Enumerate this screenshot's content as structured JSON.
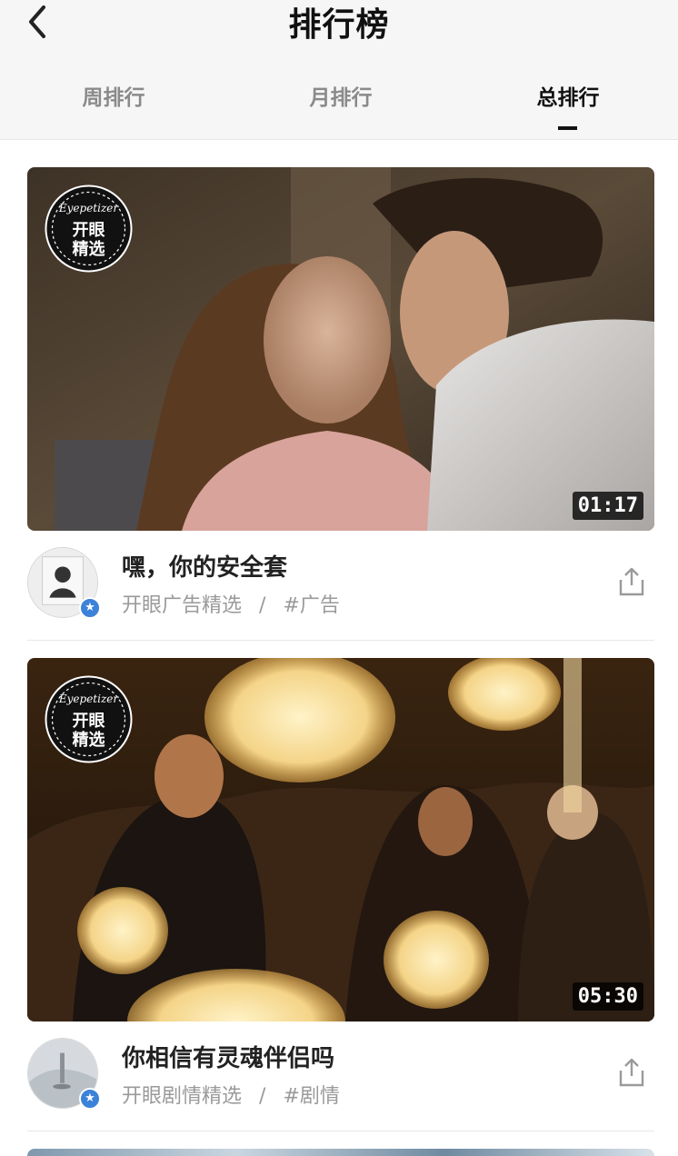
{
  "header": {
    "title": "排行榜",
    "tabs": [
      {
        "label": "周排行",
        "active": false
      },
      {
        "label": "月排行",
        "active": false
      },
      {
        "label": "总排行",
        "active": true
      }
    ]
  },
  "badge": {
    "brand": "Eyepetizer",
    "brand_cn": "开眼",
    "line1": "开眼",
    "line2": "精选"
  },
  "videos": [
    {
      "title": "嘿，你的安全套",
      "author": "开眼广告精选",
      "separator": "/",
      "tag": "#广告",
      "duration": "01:17",
      "thumbnail": "couple-scene"
    },
    {
      "title": "你相信有灵魂伴侣吗",
      "author": "开眼剧情精选",
      "separator": "/",
      "tag": "#剧情",
      "duration": "05:30",
      "thumbnail": "bokeh-crowd-scene"
    }
  ],
  "icons": [
    "back-arrow-icon",
    "share-icon",
    "verified-star-icon"
  ],
  "colors": {
    "accent": "#111111",
    "verified": "#3b82d8",
    "muted": "#9a9a9a"
  }
}
